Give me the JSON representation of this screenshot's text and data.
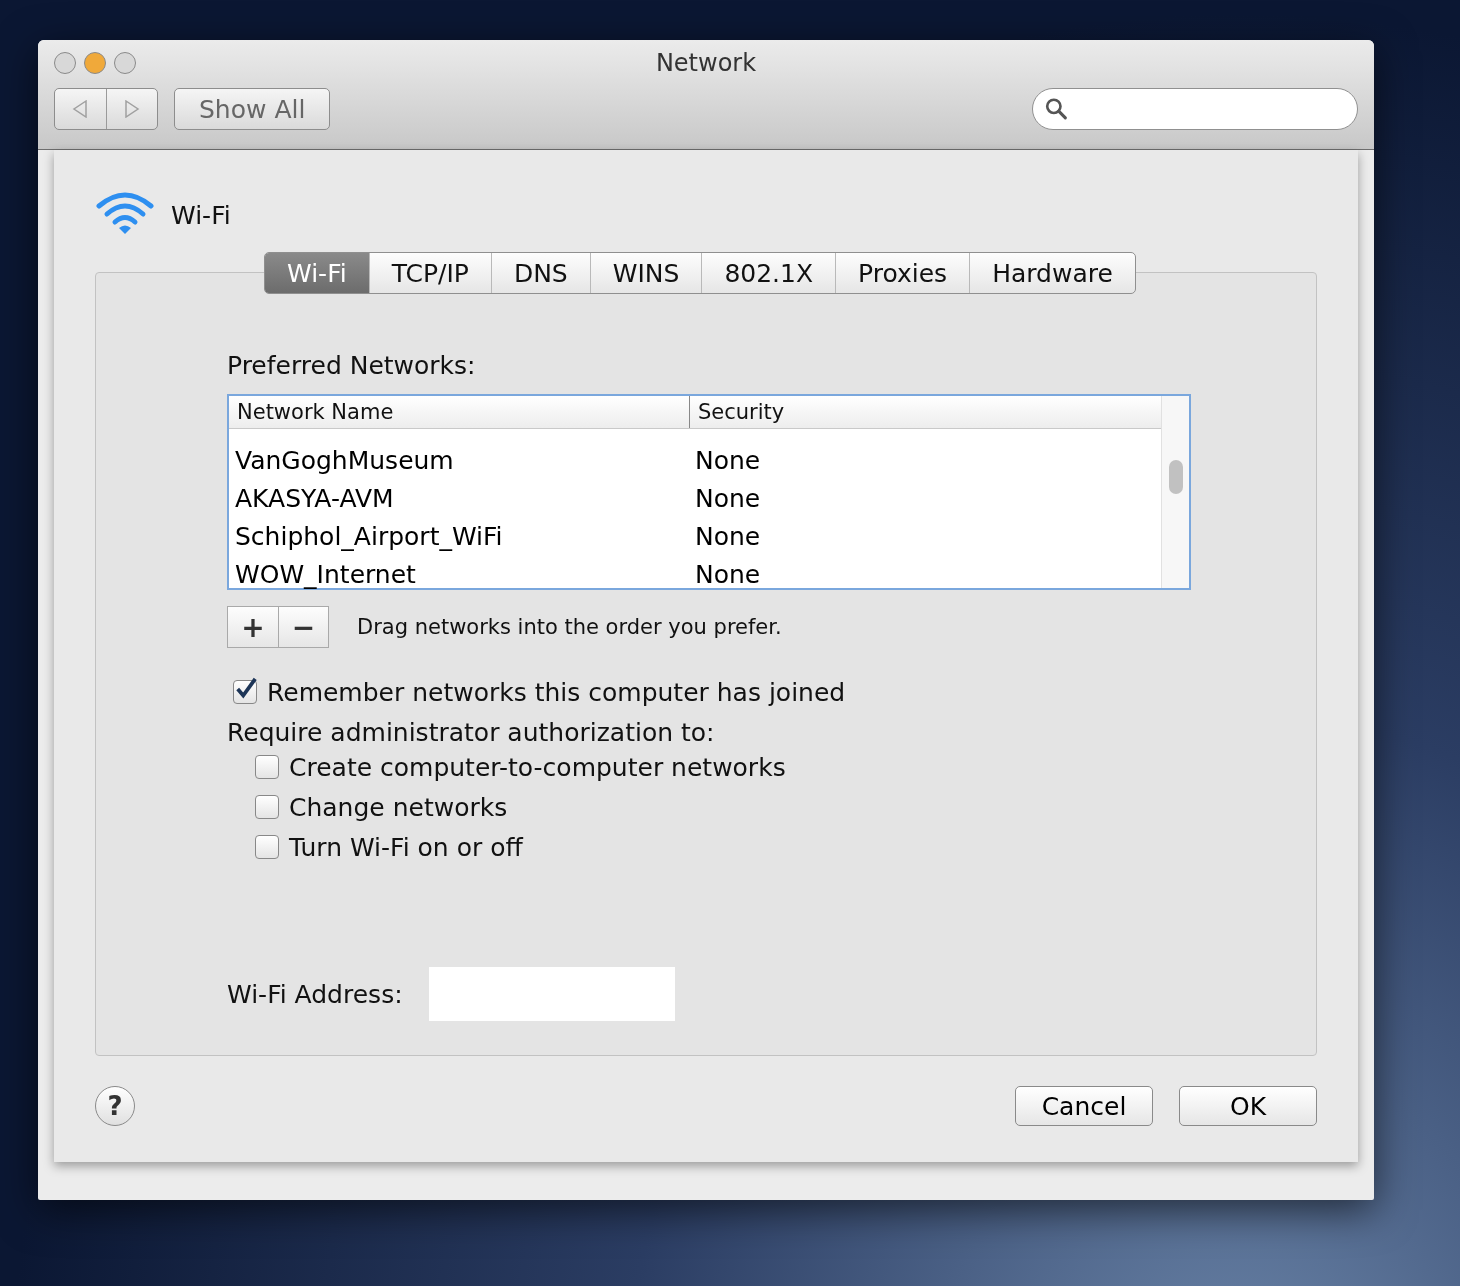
{
  "window": {
    "title": "Network",
    "show_all": "Show All"
  },
  "header": {
    "service": "Wi-Fi"
  },
  "tabs": [
    {
      "label": "Wi-Fi",
      "selected": true
    },
    {
      "label": "TCP/IP",
      "selected": false
    },
    {
      "label": "DNS",
      "selected": false
    },
    {
      "label": "WINS",
      "selected": false
    },
    {
      "label": "802.1X",
      "selected": false
    },
    {
      "label": "Proxies",
      "selected": false
    },
    {
      "label": "Hardware",
      "selected": false
    }
  ],
  "preferred_networks": {
    "title": "Preferred Networks:",
    "columns": [
      "Network Name",
      "Security"
    ],
    "rows": [
      {
        "name": "VanGoghMuseum",
        "security": "None"
      },
      {
        "name": "AKASYA-AVM",
        "security": "None"
      },
      {
        "name": "Schiphol_Airport_WiFi",
        "security": "None"
      },
      {
        "name": "WOW_Internet",
        "security": "None"
      }
    ],
    "add": "+",
    "remove": "−",
    "hint": "Drag networks into the order you prefer."
  },
  "remember": {
    "label": "Remember networks this computer has joined",
    "checked": true
  },
  "require_title": "Require administrator authorization to:",
  "require_options": [
    {
      "label": "Create computer-to-computer networks",
      "checked": false
    },
    {
      "label": "Change networks",
      "checked": false
    },
    {
      "label": "Turn Wi-Fi on or off",
      "checked": false
    }
  ],
  "address": {
    "label": "Wi-Fi Address:"
  },
  "footer": {
    "help": "?",
    "buttons": [
      "Cancel",
      "OK"
    ]
  }
}
